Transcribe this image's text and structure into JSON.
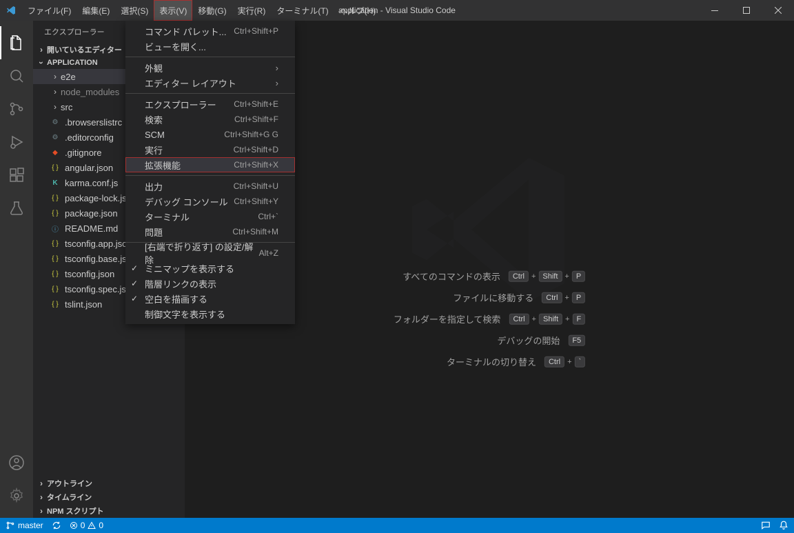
{
  "title": "application - Visual Studio Code",
  "menubar": [
    "ファイル(F)",
    "編集(E)",
    "選択(S)",
    "表示(V)",
    "移動(G)",
    "実行(R)",
    "ターミナル(T)",
    "ヘルプ(H)"
  ],
  "menubar_active_index": 3,
  "sidebar": {
    "title": "エクスプローラー",
    "sections": {
      "open_editors": "開いているエディター",
      "root": "APPLICATION",
      "outline": "アウトライン",
      "timeline": "タイムライン",
      "npm_scripts": "NPM スクリプト"
    },
    "tree": [
      {
        "label": "e2e",
        "type": "folder",
        "depth": 1,
        "expanded": false,
        "selected": true
      },
      {
        "label": "node_modules",
        "type": "folder",
        "depth": 1,
        "expanded": false,
        "dim": true
      },
      {
        "label": "src",
        "type": "folder",
        "depth": 1,
        "expanded": false
      },
      {
        "label": ".browserslistrc",
        "type": "file",
        "depth": 1,
        "icon": "gear",
        "color": "#6d8086"
      },
      {
        "label": ".editorconfig",
        "type": "file",
        "depth": 1,
        "icon": "gear",
        "color": "#6d8086"
      },
      {
        "label": ".gitignore",
        "type": "file",
        "depth": 1,
        "icon": "git",
        "color": "#e44d26"
      },
      {
        "label": "angular.json",
        "type": "file",
        "depth": 1,
        "icon": "json",
        "color": "#cbcb41"
      },
      {
        "label": "karma.conf.js",
        "type": "file",
        "depth": 1,
        "icon": "karma",
        "color": "#4db6ac"
      },
      {
        "label": "package-lock.json",
        "type": "file",
        "depth": 1,
        "icon": "json",
        "color": "#cbcb41"
      },
      {
        "label": "package.json",
        "type": "file",
        "depth": 1,
        "icon": "json",
        "color": "#cbcb41"
      },
      {
        "label": "README.md",
        "type": "file",
        "depth": 1,
        "icon": "info",
        "color": "#519aba"
      },
      {
        "label": "tsconfig.app.json",
        "type": "file",
        "depth": 1,
        "icon": "json",
        "color": "#cbcb41"
      },
      {
        "label": "tsconfig.base.json",
        "type": "file",
        "depth": 1,
        "icon": "json",
        "color": "#cbcb41"
      },
      {
        "label": "tsconfig.json",
        "type": "file",
        "depth": 1,
        "icon": "json",
        "color": "#cbcb41"
      },
      {
        "label": "tsconfig.spec.json",
        "type": "file",
        "depth": 1,
        "icon": "json",
        "color": "#cbcb41"
      },
      {
        "label": "tslint.json",
        "type": "file",
        "depth": 1,
        "icon": "json",
        "color": "#cbcb41"
      }
    ]
  },
  "dropdown": [
    {
      "label": "コマンド パレット...",
      "shortcut": "Ctrl+Shift+P"
    },
    {
      "label": "ビューを開く..."
    },
    {
      "sep": true
    },
    {
      "label": "外観",
      "submenu": true
    },
    {
      "label": "エディター レイアウト",
      "submenu": true
    },
    {
      "sep": true
    },
    {
      "label": "エクスプローラー",
      "shortcut": "Ctrl+Shift+E"
    },
    {
      "label": "検索",
      "shortcut": "Ctrl+Shift+F"
    },
    {
      "label": "SCM",
      "shortcut": "Ctrl+Shift+G G"
    },
    {
      "label": "実行",
      "shortcut": "Ctrl+Shift+D"
    },
    {
      "label": "拡張機能",
      "shortcut": "Ctrl+Shift+X",
      "highlighted": true
    },
    {
      "sep": true
    },
    {
      "label": "出力",
      "shortcut": "Ctrl+Shift+U"
    },
    {
      "label": "デバッグ コンソール",
      "shortcut": "Ctrl+Shift+Y"
    },
    {
      "label": "ターミナル",
      "shortcut": "Ctrl+`"
    },
    {
      "label": "問題",
      "shortcut": "Ctrl+Shift+M"
    },
    {
      "sep": true
    },
    {
      "label": "[右端で折り返す] の設定/解除",
      "shortcut": "Alt+Z"
    },
    {
      "label": "ミニマップを表示する",
      "checked": true
    },
    {
      "label": "階層リンクの表示",
      "checked": true
    },
    {
      "label": "空白を描画する",
      "checked": true
    },
    {
      "label": "制御文字を表示する"
    }
  ],
  "welcome": [
    {
      "label": "すべてのコマンドの表示",
      "keys": [
        "Ctrl",
        "+",
        "Shift",
        "+",
        "P"
      ]
    },
    {
      "label": "ファイルに移動する",
      "keys": [
        "Ctrl",
        "+",
        "P"
      ]
    },
    {
      "label": "フォルダーを指定して検索",
      "keys": [
        "Ctrl",
        "+",
        "Shift",
        "+",
        "F"
      ]
    },
    {
      "label": "デバッグの開始",
      "keys": [
        "F5"
      ]
    },
    {
      "label": "ターミナルの切り替え",
      "keys": [
        "Ctrl",
        "+",
        "`"
      ]
    }
  ],
  "statusbar": {
    "branch": "master",
    "errors": "0",
    "warnings": "0"
  }
}
